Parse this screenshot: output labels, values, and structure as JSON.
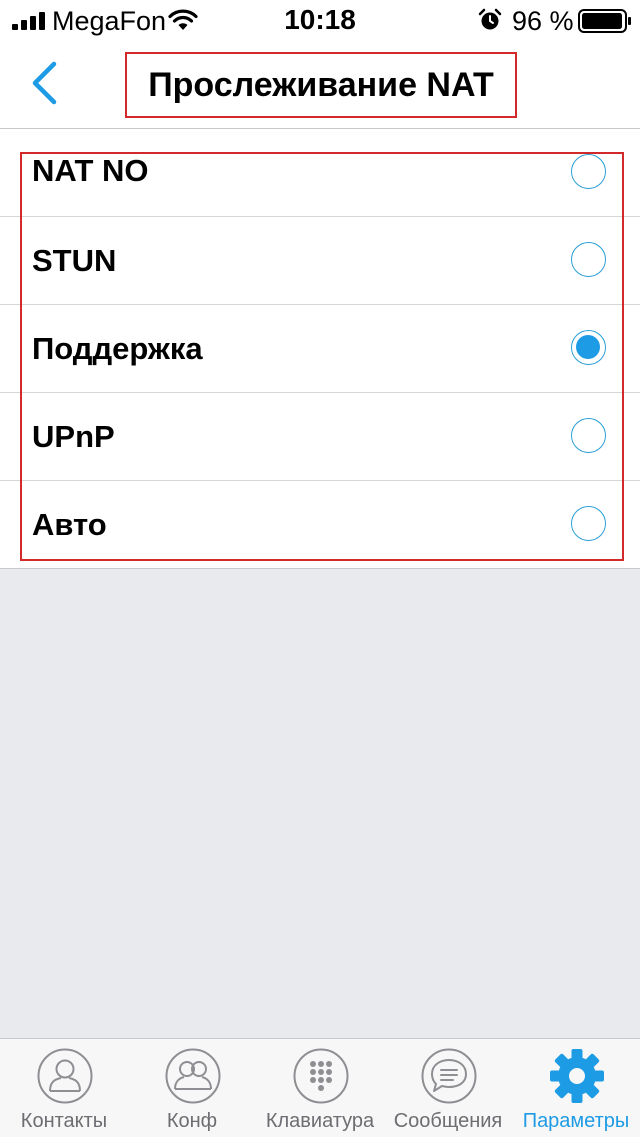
{
  "status_bar": {
    "carrier": "MegaFon",
    "time": "10:18",
    "battery": "96 %"
  },
  "nav": {
    "title": "Прослеживание NAT"
  },
  "options": [
    {
      "label": "NAT NO",
      "selected": false
    },
    {
      "label": "STUN",
      "selected": false
    },
    {
      "label": "Поддержка",
      "selected": true
    },
    {
      "label": "UPnP",
      "selected": false
    },
    {
      "label": "Авто",
      "selected": false
    }
  ],
  "tabs": [
    {
      "label": "Контакты",
      "icon": "contact-icon",
      "active": false
    },
    {
      "label": "Конф",
      "icon": "conference-icon",
      "active": false
    },
    {
      "label": "Клавиатура",
      "icon": "keypad-icon",
      "active": false
    },
    {
      "label": "Сообщения",
      "icon": "messages-icon",
      "active": false
    },
    {
      "label": "Параметры",
      "icon": "gear-icon",
      "active": true
    }
  ],
  "colors": {
    "accent": "#1e9be5",
    "highlight_border": "#d22a2a",
    "background": "#e8eaed"
  }
}
